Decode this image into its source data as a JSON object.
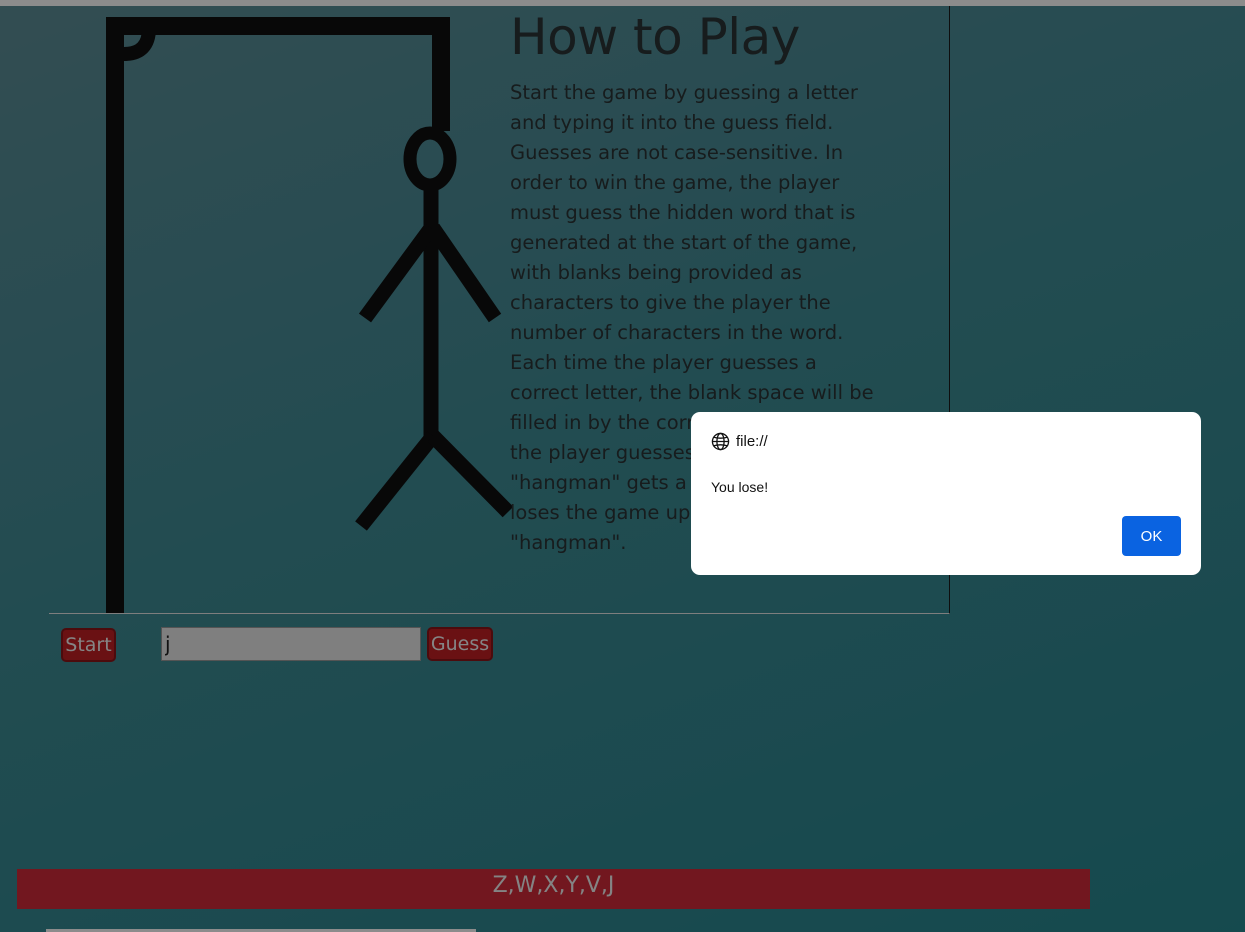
{
  "howto": {
    "title": "How to Play",
    "text": "Start the game by guessing a letter and typing it into the guess field. Guesses are not case-sensitive. In order to win the game, the player must guess the hidden word that is generated at the start of the game, with blanks being provided as characters to give the player the number of characters in the word. Each time the player guesses a correct letter, the blank space will be filled in by the corresponding letter. If the player guesses an incorrect letter, \"hangman\" gets a part added. Player loses the game upon completing \"hangman\"."
  },
  "controls": {
    "start_label": "Start",
    "guess_value": "j",
    "guess_label": "Guess"
  },
  "guessed_letters": "Z,W,X,Y,V,J",
  "dialog": {
    "origin": "file://",
    "message": "You lose!",
    "ok_label": "OK"
  },
  "colors": {
    "accent_red": "#c21f24",
    "dialog_button": "#0a63e1"
  }
}
